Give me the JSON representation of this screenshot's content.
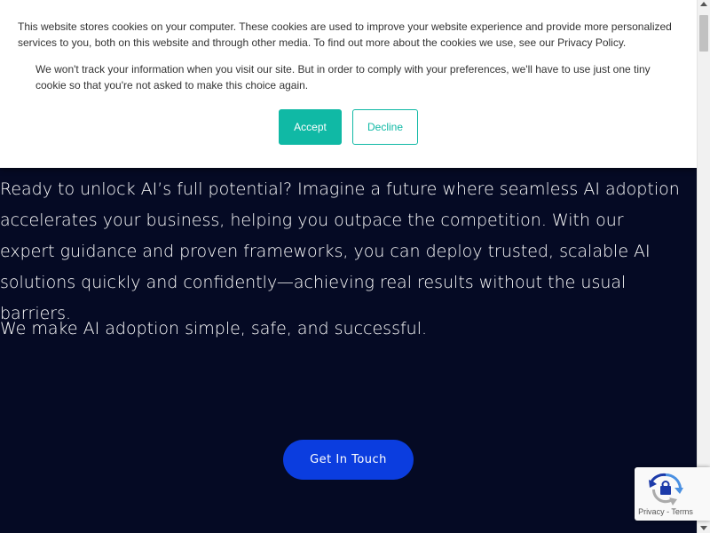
{
  "hero": {
    "paragraph_1": "Ready to unlock AI’s full potential? Imagine a future where seamless AI adoption accelerates your business, helping you outpace the competition. With our expert guidance and proven frameworks, you can deploy trusted, scalable AI solutions quickly and confidently—achieving real results without the usual barriers.",
    "paragraph_2": "We make AI adoption simple, safe, and successful.",
    "cta_label": "Get In Touch"
  },
  "cookie_banner": {
    "text_1": "This website stores cookies on your computer. These cookies are used to improve your website experience and provide more personalized services to you, both on this website and through other media. To find out more about the cookies we use, see our Privacy Policy.",
    "text_2": "We won't track your information when you visit our site. But in order to comply with your preferences, we'll have to use just one tiny cookie so that you're not asked to make this choice again.",
    "accept_label": "Accept",
    "decline_label": "Decline"
  },
  "recaptcha": {
    "privacy_label": "Privacy",
    "separator": " - ",
    "terms_label": "Terms",
    "icon": "recaptcha-logo-icon"
  },
  "colors": {
    "background": "#050a24",
    "cta": "#0b3ddf",
    "cookie_accent": "#10b9a5"
  }
}
